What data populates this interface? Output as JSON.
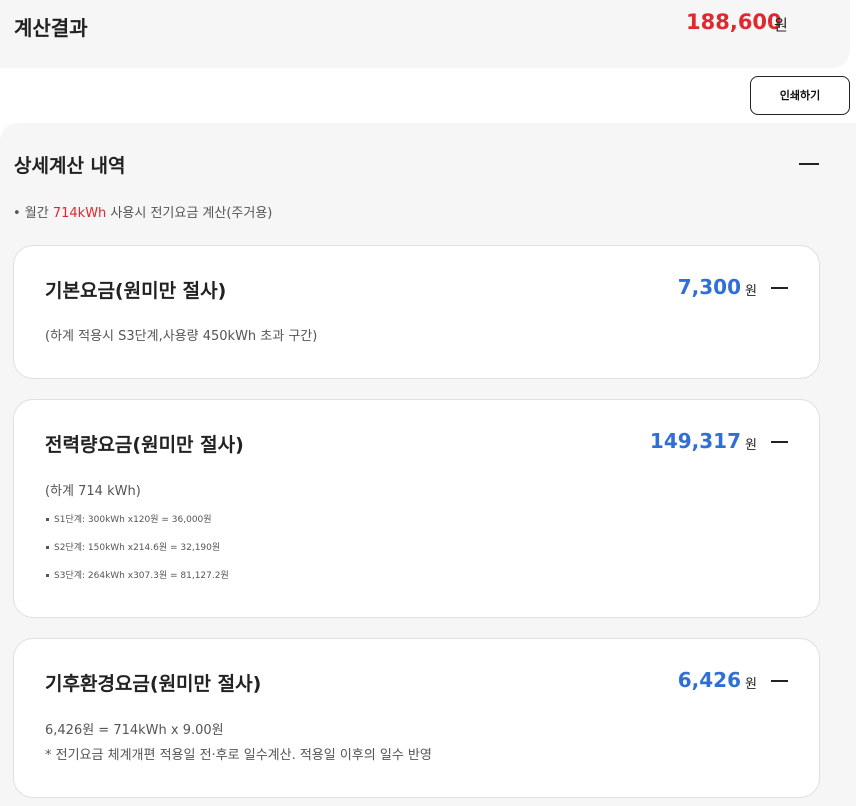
{
  "result": {
    "title": "계산결과",
    "amount": "188,600",
    "unit": "원"
  },
  "print_button": "인쇄하기",
  "detail": {
    "title": "상세계산 내역",
    "desc_prefix": "• 월간 ",
    "desc_highlight": "714kWh",
    "desc_suffix": " 사용시 전기요금 계산(주거용)"
  },
  "cards": [
    {
      "title": "기본요금(원미만 절사)",
      "amount": "7,300",
      "unit": "원",
      "notes": [
        "(하계 적용시 S3단계,사용량 450kWh 초과 구간)"
      ]
    },
    {
      "title": "전력량요금(원미만 절사)",
      "amount": "149,317",
      "unit": "원",
      "notes": [
        "(하계 714 kWh)"
      ],
      "steps": [
        "S1단계: 300kWh x120원 = 36,000원",
        "S2단계: 150kWh x214.6원 = 32,190원",
        "S3단계: 264kWh x307.3원 = 81,127.2원"
      ]
    },
    {
      "title": "기후환경요금(원미만 절사)",
      "amount": "6,426",
      "unit": "원",
      "notes": [
        "6,426원 = 714kWh x 9.00원",
        "* 전기요금 체계개편 적용일 전·후로 일수계산. 적용일 이후의 일수 반영"
      ]
    }
  ],
  "colors": {
    "total_amount": "#e0282f",
    "card_amount": "#2f6fd6",
    "section_bg": "#f6f6f6"
  }
}
